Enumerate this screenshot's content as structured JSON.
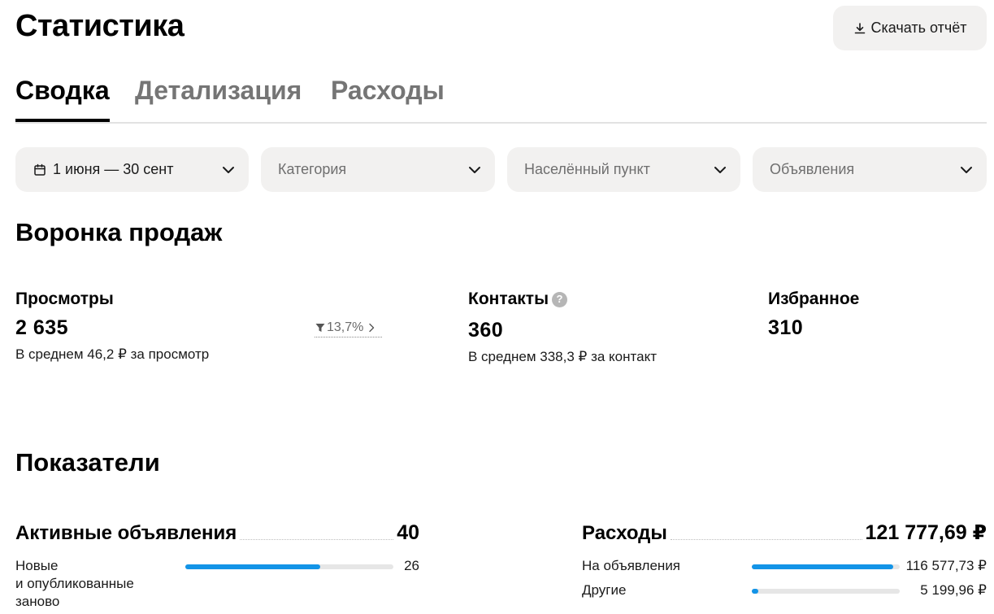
{
  "header": {
    "title": "Статистика",
    "download_label": "Скачать отчёт"
  },
  "tabs": [
    {
      "label": "Сводка",
      "active": true
    },
    {
      "label": "Детализация",
      "active": false
    },
    {
      "label": "Расходы",
      "active": false
    }
  ],
  "filters": {
    "date_range": "1 июня — 30 сент",
    "category_placeholder": "Категория",
    "city_placeholder": "Населённый пункт",
    "ads_placeholder": "Объявления"
  },
  "funnel": {
    "title": "Воронка продаж",
    "views": {
      "label": "Просмотры",
      "value": "2 635",
      "sub": "В среднем 46,2 ₽ за просмотр",
      "conversion": "13,7%"
    },
    "contacts": {
      "label": "Контакты",
      "value": "360",
      "sub": "В среднем 338,3 ₽ за контакт"
    },
    "favorites": {
      "label": "Избранное",
      "value": "310"
    }
  },
  "indicators": {
    "title": "Показатели",
    "active_ads": {
      "label": "Активные объявления",
      "total": "40",
      "rows": [
        {
          "label": "Новые\nи опубликованные\nзаново",
          "value": "26",
          "fraction": 0.65
        }
      ]
    },
    "expenses": {
      "label": "Расходы",
      "total": "121 777,69 ₽",
      "rows": [
        {
          "label": "На объявления",
          "value": "116 577,73 ₽",
          "fraction": 0.957
        },
        {
          "label": "Другие",
          "value": "5 199,96 ₽",
          "fraction": 0.043
        }
      ]
    }
  },
  "colors": {
    "accent": "#1394e7",
    "control_bg": "#f2f1f0",
    "muted_text": "#757575"
  }
}
